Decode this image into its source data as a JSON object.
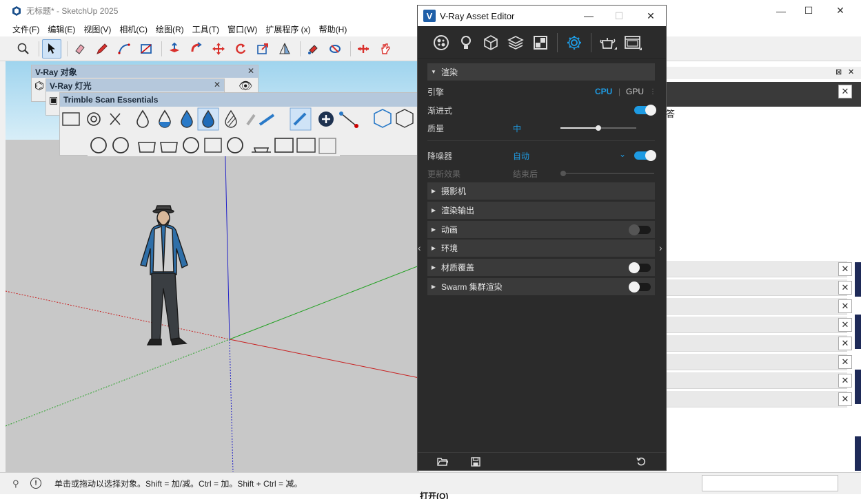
{
  "window": {
    "title": "无标题* - SketchUp 2025",
    "minimize": "—",
    "maximize": "☐",
    "close": "✕"
  },
  "menu": [
    "文件(F)",
    "编辑(E)",
    "视图(V)",
    "相机(C)",
    "绘图(R)",
    "工具(T)",
    "窗口(W)",
    "扩展程序 (x)",
    "帮助(H)"
  ],
  "toolbar": {
    "icons": [
      "zoom-icon",
      "select-arrow-icon",
      "eraser-icon",
      "pencil-line-icon",
      "arc-icon",
      "rectangle-icon",
      "push-pull-icon",
      "follow-me-icon",
      "move-icon",
      "rotate-icon",
      "scale-icon",
      "section-plane-icon",
      "paint-icon",
      "orbit-icon",
      "pan-icon",
      "hand-icon"
    ]
  },
  "floating_toolbars": {
    "vray_objects": {
      "title": "V-Ray 对象",
      "close": "✕"
    },
    "vray_lights": {
      "title": "V-Ray 灯光",
      "close": "✕"
    },
    "trimble_scan": {
      "title": "Trimble Scan Essentials"
    }
  },
  "statusbar": {
    "text": "单击或拖动以选择对象。Shift = 加/减。Ctrl = 加。Shift + Ctrl = 减。"
  },
  "bottom": {
    "cut_text": "打开(O)"
  },
  "tray": {
    "fragment_text": "答",
    "close": "✕"
  },
  "vray_editor": {
    "title": "V-Ray Asset Editor",
    "minimize": "—",
    "maximize": "☐",
    "close": "✕",
    "render_section": {
      "header": "渲染",
      "engine_label": "引擎",
      "engine_cpu": "CPU",
      "engine_gpu": "GPU",
      "progressive_label": "渐进式",
      "progressive_on": true,
      "quality_label": "质量",
      "quality_value": "中",
      "quality_slider": 0.5,
      "denoiser_label": "降噪器",
      "denoiser_value": "自动",
      "denoiser_on": true,
      "update_effects_label": "更新效果",
      "update_effects_value": "结束后",
      "update_effects_slider": 0.0
    },
    "sections": [
      {
        "label": "摄影机",
        "toggle": null
      },
      {
        "label": "渲染输出",
        "toggle": null
      },
      {
        "label": "动画",
        "toggle": "off-dim"
      },
      {
        "label": "环境",
        "toggle": null
      },
      {
        "label": "材质覆盖",
        "toggle": "off"
      },
      {
        "label": "Swarm 集群渲染",
        "toggle": "off"
      }
    ],
    "footer_icons": [
      "open-folder-icon",
      "save-icon",
      "reset-icon"
    ]
  },
  "colors": {
    "accent": "#1e9be3",
    "panel_bg": "#2b2b2b",
    "section_bg": "#3a3a3a",
    "sky": "#cce8f6",
    "ground": "#c8c8c8",
    "title_blue": "#b5c8dc"
  }
}
